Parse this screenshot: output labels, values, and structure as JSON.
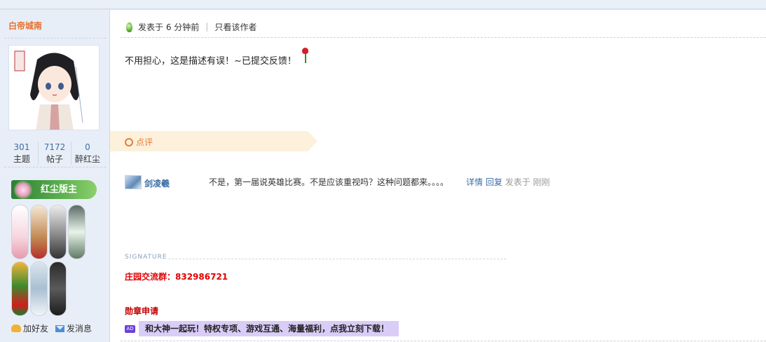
{
  "author": {
    "name": "白帝城南",
    "stats": [
      {
        "value": "301",
        "label": "主题"
      },
      {
        "value": "7172",
        "label": "帖子"
      },
      {
        "value": "0",
        "label": "醉红尘"
      }
    ],
    "group": "红尘版主",
    "actions": {
      "add_friend": "加好友",
      "send_message": "发消息"
    }
  },
  "post": {
    "meta_prefix": "发表于",
    "meta_time": "6 分钟前",
    "only_author": "只看该作者",
    "content": "不用担心，这是描述有误！~已提交反馈！"
  },
  "comments": {
    "header": "点评",
    "items": [
      {
        "author": "剑凌羲",
        "text": "不是，第一届说英雄比赛。不是应该重视吗？这种问题都来。。。。",
        "detail": "详情",
        "reply": "回复",
        "posted_prefix": "发表于",
        "posted_time": "刚刚"
      }
    ]
  },
  "signature": {
    "title": "SIGNATURE",
    "line": "庄园交流群：832986721"
  },
  "medal_apply": "勋章申请",
  "ad": {
    "badge": "AD",
    "text": "和大神一起玩！特权专项、游戏互通、海量福利，点我立刻下载！"
  },
  "colors": {
    "accent_orange": "#e8702a",
    "link_blue": "#3e6ea5",
    "signature_red": "#e00000",
    "sidebar_bg": "#e8eef7"
  }
}
